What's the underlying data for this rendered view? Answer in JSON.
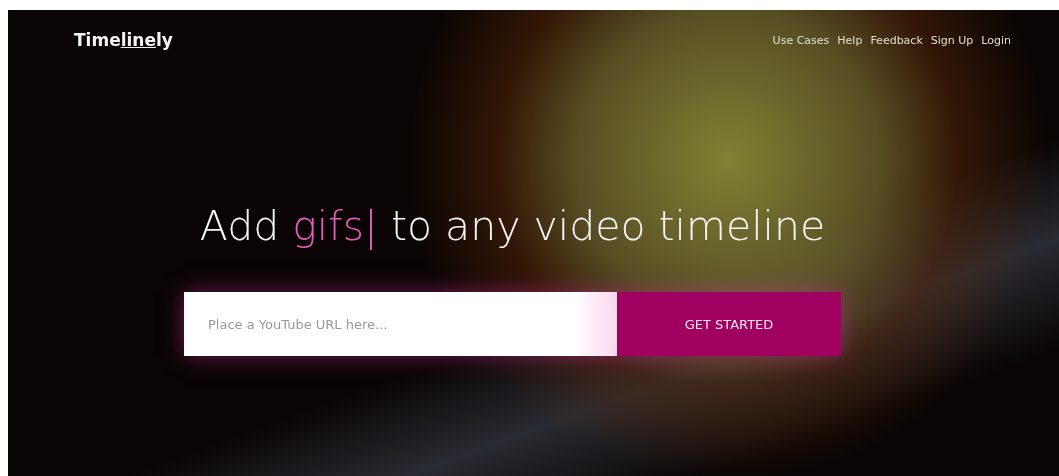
{
  "logo": {
    "parts": [
      {
        "text": "Time",
        "underlined": false
      },
      {
        "text": "line",
        "underlined": true
      },
      {
        "text": "ly",
        "underlined": false
      }
    ]
  },
  "nav": {
    "links": [
      "Use Cases",
      "Help",
      "Feedback",
      "Sign Up",
      "Login"
    ]
  },
  "headline": {
    "parts": [
      {
        "text": "Add ",
        "highlighted": false
      },
      {
        "text": "gifs|",
        "highlighted": true
      },
      {
        "text": " to any video timeline",
        "highlighted": false
      }
    ]
  },
  "url_field": {
    "placeholder": "Place a YouTube URL here..."
  },
  "cta_button": {
    "label": "GET STARTED"
  }
}
